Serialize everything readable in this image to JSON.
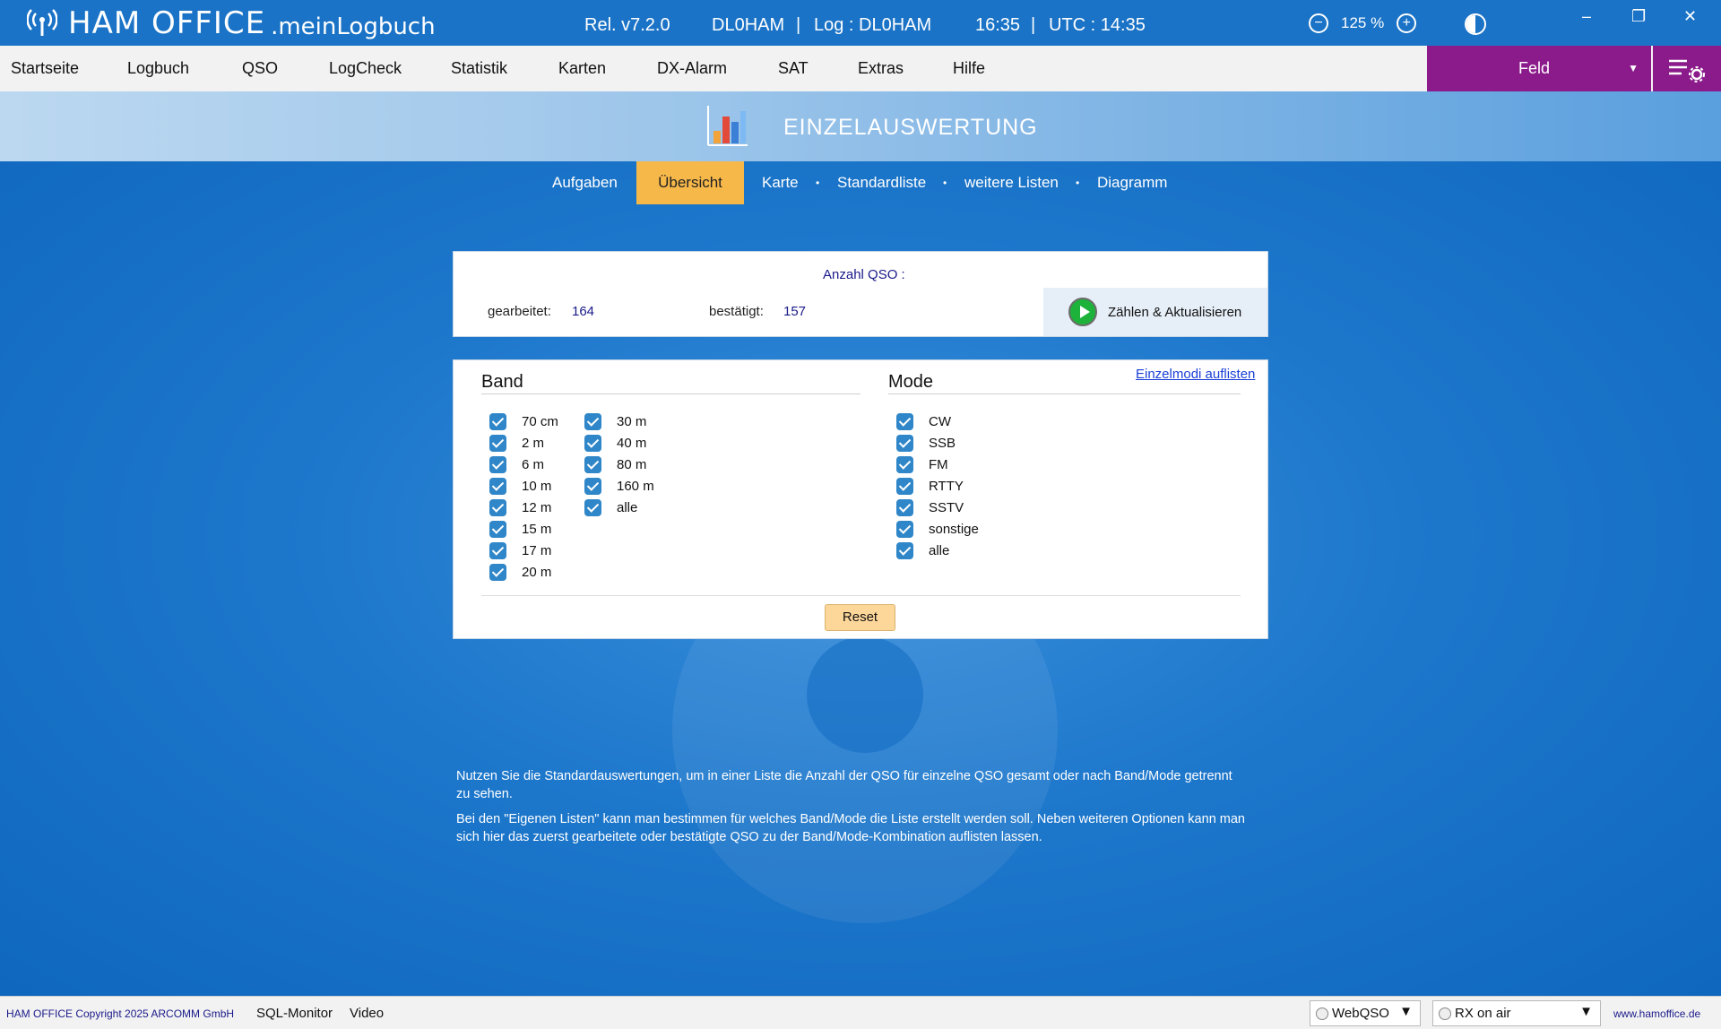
{
  "app": {
    "name": "HAM OFFICE",
    "subtitle": ".meinLogbuch",
    "release": "Rel. v7.2.0",
    "callsign": "DL0HAM",
    "separator1": "|",
    "log": "Log : DL0HAM",
    "time": "16:35",
    "separator2": "|",
    "utc": "UTC : 14:35",
    "zoom": "125 %"
  },
  "window_controls": {
    "minimize": "–",
    "restore": "❐",
    "close": "✕"
  },
  "menu": {
    "items": [
      "Startseite",
      "Logbuch",
      "QSO",
      "LogCheck",
      "Statistik",
      "Karten",
      "DX-Alarm",
      "SAT",
      "Extras",
      "Hilfe"
    ],
    "profile": "Feld"
  },
  "page": {
    "title": "EINZELAUSWERTUNG"
  },
  "tabs": {
    "items": [
      "Aufgaben",
      "Übersicht",
      "Karte",
      "Standardliste",
      "weitere Listen",
      "Diagramm"
    ],
    "active": "Übersicht",
    "dot": "•"
  },
  "summary": {
    "heading": "Anzahl QSO :",
    "worked_label": "gearbeitet:",
    "worked_value": "164",
    "confirmed_label": "bestätigt:",
    "confirmed_value": "157",
    "count_button": "Zählen & Aktualisieren"
  },
  "filters": {
    "band_title": "Band",
    "mode_title": "Mode",
    "list_modes_link": "Einzelmodi auflisten",
    "bands_col1": [
      "70 cm",
      "2 m",
      "6 m",
      "10 m",
      "12 m",
      "15 m",
      "17 m",
      "20 m"
    ],
    "bands_col2": [
      "30 m",
      "40 m",
      "80 m",
      "160 m",
      "alle"
    ],
    "modes": [
      "CW",
      "SSB",
      "FM",
      "RTTY",
      "SSTV",
      "sonstige",
      "alle"
    ],
    "reset": "Reset"
  },
  "info": {
    "p1": "Nutzen Sie die Standardauswertungen, um in einer Liste die Anzahl der QSO für einzelne QSO gesamt  oder nach Band/Mode getrennt zu sehen.",
    "p2": "Bei den \"Eigenen Listen\" kann man bestimmen für welches Band/Mode die Liste erstellt werden soll. Neben weiteren Optionen  kann man sich hier das zuerst gearbeitete oder bestätigte QSO zu der Band/Mode-Kombination auflisten lassen."
  },
  "statusbar": {
    "copyright": "HAM OFFICE Copyright 2025 ARCOMM GmbH",
    "sql_monitor": "SQL-Monitor",
    "video": "Video",
    "webqso": "WebQSO",
    "rx": "RX on air",
    "website": "www.hamoffice.de"
  },
  "colors": {
    "titlebar": "#1a73c6",
    "accent_purple": "#8b1a8b",
    "active_tab": "#f7b84a",
    "checkbox": "#2f86c8",
    "play_green": "#1db33a"
  }
}
